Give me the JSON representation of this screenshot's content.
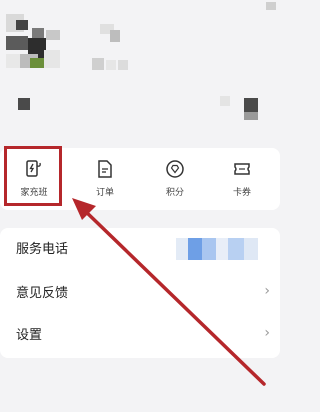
{
  "services": [
    {
      "label": "家充班",
      "icon": "charger-icon"
    },
    {
      "label": "订单",
      "icon": "order-icon"
    },
    {
      "label": "积分",
      "icon": "points-icon"
    },
    {
      "label": "卡券",
      "icon": "coupon-icon"
    }
  ],
  "menu": [
    {
      "label": "服务电话"
    },
    {
      "label": "意见反馈",
      "chevron": "›"
    },
    {
      "label": "设置",
      "chevron": "›"
    }
  ],
  "colors": {
    "highlight": "#b5272b",
    "background": "#f3f3f5",
    "card": "#ffffff"
  }
}
